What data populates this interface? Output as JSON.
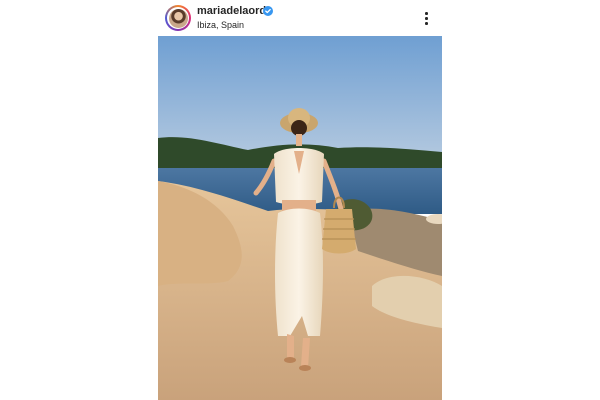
{
  "post": {
    "username": "mariadelaord",
    "location": "Ibiza, Spain",
    "verified": true,
    "icons": {
      "avatar": "profile-avatar",
      "verified": "verified-badge-icon",
      "more": "more-options-icon"
    },
    "colors": {
      "text": "#262626",
      "verified": "#3897f0",
      "sky": "#7ea8d6",
      "sea": "#3e6a93"
    }
  }
}
